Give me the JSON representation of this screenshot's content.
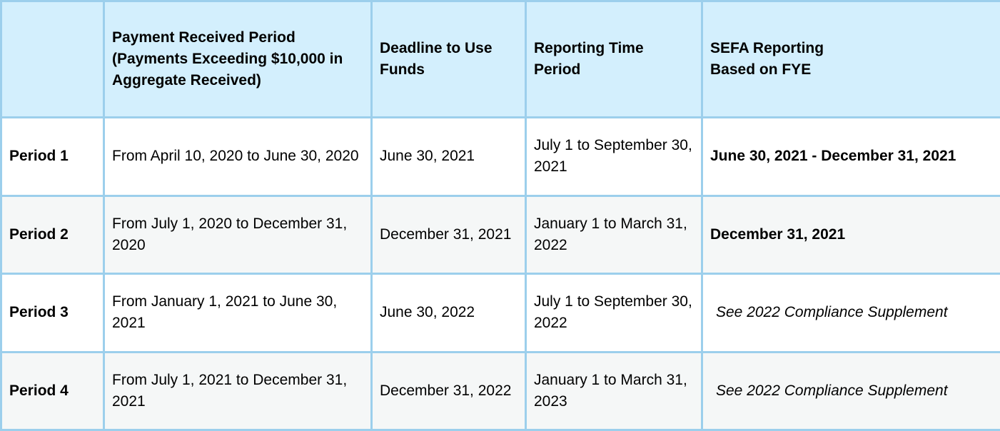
{
  "table": {
    "headers": [
      {
        "lines": [
          ""
        ]
      },
      {
        "lines": [
          "Payment Received Period",
          "(Payments Exceeding $10,000 in",
          "Aggregate Received)"
        ]
      },
      {
        "lines": [
          "Deadline to Use",
          "Funds"
        ]
      },
      {
        "lines": [
          "Reporting Time",
          "Period"
        ]
      },
      {
        "lines": [
          "SEFA Reporting",
          "Based on FYE"
        ]
      }
    ],
    "rows": [
      {
        "period": "Period 1",
        "payment_received": "From April 10, 2020 to June 30, 2020",
        "deadline": "June 30, 2021",
        "reporting_time": "July 1 to September 30, 2021",
        "sefa": "June 30, 2021 - December 31, 2021",
        "sefa_style": "bold"
      },
      {
        "period": "Period 2",
        "payment_received": "From July 1, 2020 to December 31, 2020",
        "deadline": "December 31, 2021",
        "reporting_time": "January 1 to March 31, 2022",
        "sefa": "December 31, 2021",
        "sefa_style": "bold"
      },
      {
        "period": "Period 3",
        "payment_received": "From January 1, 2021 to June 30, 2021",
        "deadline": "June 30, 2022",
        "reporting_time": "July 1 to September 30, 2022",
        "sefa": "See 2022 Compliance Supplement",
        "sefa_style": "italic"
      },
      {
        "period": "Period 4",
        "payment_received": "From July 1, 2021 to December 31, 2021",
        "deadline": "December 31, 2022",
        "reporting_time": "January 1 to March 31, 2023",
        "sefa": "See 2022 Compliance Supplement",
        "sefa_style": "italic"
      }
    ]
  },
  "colors": {
    "header_bg": "#d3effd",
    "border": "#9ccfec",
    "row_alt_bg": "#f5f7f7",
    "row_bg": "#ffffff"
  }
}
